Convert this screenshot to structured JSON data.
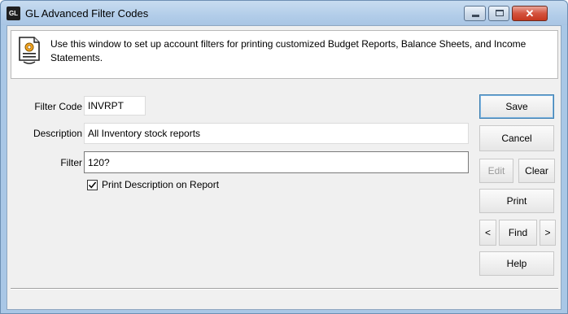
{
  "window": {
    "icon_text": "GL",
    "title": "GL Advanced Filter Codes"
  },
  "info": {
    "text": "Use this window to set up account filters for printing customized Budget Reports, Balance Sheets, and Income Statements."
  },
  "form": {
    "filter_code_label": "Filter Code",
    "filter_code_value": "INVRPT",
    "description_label": "Description",
    "description_value": "All Inventory stock reports",
    "filter_label": "Filter",
    "filter_value": "120?",
    "print_description_label": "Print Description on Report",
    "print_description_checked": true
  },
  "buttons": {
    "save": "Save",
    "cancel": "Cancel",
    "edit": "Edit",
    "clear": "Clear",
    "print": "Print",
    "prev": "<",
    "find": "Find",
    "next": ">",
    "help": "Help"
  },
  "colors": {
    "titlebar": "#b2cde9",
    "close_button": "#c6381f",
    "default_button_border": "#3c7fb1"
  }
}
